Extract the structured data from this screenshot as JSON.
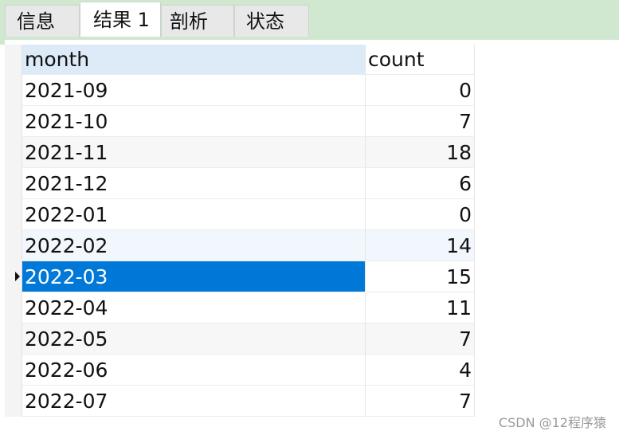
{
  "tabs": [
    {
      "label": "信息"
    },
    {
      "label": "结果 1"
    },
    {
      "label": "剖析"
    },
    {
      "label": "状态"
    }
  ],
  "table": {
    "columns": [
      "month",
      "count"
    ],
    "rows": [
      {
        "month": "2021-09",
        "count": "0"
      },
      {
        "month": "2021-10",
        "count": "7"
      },
      {
        "month": "2021-11",
        "count": "18"
      },
      {
        "month": "2021-12",
        "count": "6"
      },
      {
        "month": "2022-01",
        "count": "0"
      },
      {
        "month": "2022-02",
        "count": "14"
      },
      {
        "month": "2022-03",
        "count": "15"
      },
      {
        "month": "2022-04",
        "count": "11"
      },
      {
        "month": "2022-05",
        "count": "7"
      },
      {
        "month": "2022-06",
        "count": "4"
      },
      {
        "month": "2022-07",
        "count": "7"
      }
    ],
    "selected_row_index": 6
  },
  "watermark": "CSDN @12程序猿",
  "colors": {
    "tab_strip": "#cfe8cf",
    "selection": "#0078d7",
    "header_highlight": "#dcebf7"
  }
}
